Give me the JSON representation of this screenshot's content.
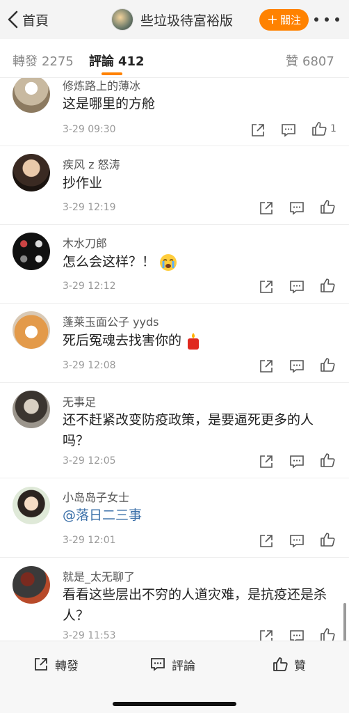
{
  "nav": {
    "back_label": "首頁",
    "title": "些垃圾待富裕版",
    "follow_label": "關注"
  },
  "tabs": {
    "repost": {
      "label": "轉發",
      "count": "2275"
    },
    "comments": {
      "label": "評論",
      "count": "412"
    },
    "likes": {
      "label": "贊",
      "count": "6807"
    }
  },
  "comments": [
    {
      "user": "修炼路上的薄冰",
      "text": "这是哪里的方舱",
      "time": "3-29 09:30",
      "likes": "1"
    },
    {
      "user": "疾风 z 怒涛",
      "text": "抄作业",
      "time": "3-29 12:19",
      "likes": ""
    },
    {
      "user": "木水刀郎",
      "text": "怎么会这样？！",
      "time": "3-29 12:12",
      "likes": ""
    },
    {
      "user": "蓬莱玉面公子 yyds",
      "text": "死后冤魂去找害你的",
      "time": "3-29 12:08",
      "likes": ""
    },
    {
      "user": "无事足",
      "text": "还不赶紧改变防疫政策，是要逼死更多的人吗？",
      "time": "3-29 12:05",
      "likes": ""
    },
    {
      "user": "小岛岛子女士",
      "text": "@落日二三事",
      "time": "3-29 12:01",
      "likes": ""
    },
    {
      "user": "就是_太无聊了",
      "text": "看看这些层出不穷的人道灾难，是抗疫还是杀人？",
      "time": "3-29 11:53",
      "likes": ""
    }
  ],
  "bottom": {
    "repost_label": "轉發",
    "comment_label": "評論",
    "like_label": "贊"
  },
  "icons": [
    "back-chevron-icon",
    "more-icon",
    "repost-icon",
    "comment-icon",
    "like-icon",
    "crying-emoji-icon",
    "candle-emoji-icon"
  ],
  "colors": {
    "accent": "#ff8200",
    "mention": "#3a6fa8"
  }
}
